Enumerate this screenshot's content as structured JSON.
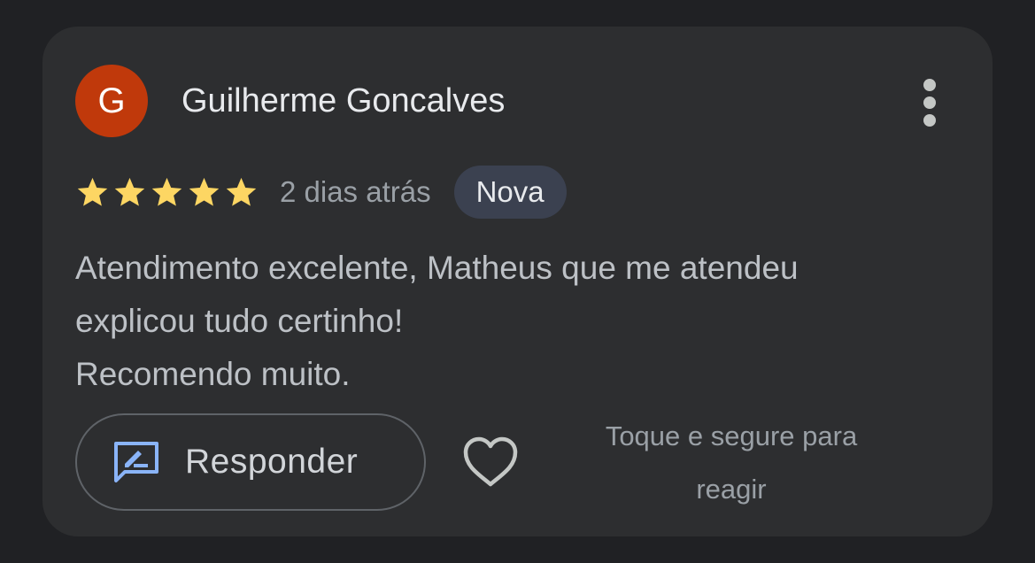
{
  "review": {
    "author_initial": "G",
    "author_name": "Guilherme Goncalves",
    "rating": 5,
    "max_rating": 5,
    "time_ago": "2 dias atrás",
    "badge": "Nova",
    "text_lines": [
      "Atendimento excelente, Matheus que me atendeu",
      "explicou tudo certinho!",
      "Recomendo muito."
    ]
  },
  "actions": {
    "reply_label": "Responder",
    "react_hint_lines": [
      "Toque e segure para",
      "reagir"
    ]
  },
  "icons": {
    "more": "more-vert-icon",
    "star": "star-icon",
    "reply": "reply-edit-icon",
    "heart": "heart-outline-icon"
  },
  "colors": {
    "avatar_bg": "#c0390b",
    "star": "#fdd663",
    "reply_icon": "#8ab4f8",
    "badge_bg": "#3b4150"
  }
}
